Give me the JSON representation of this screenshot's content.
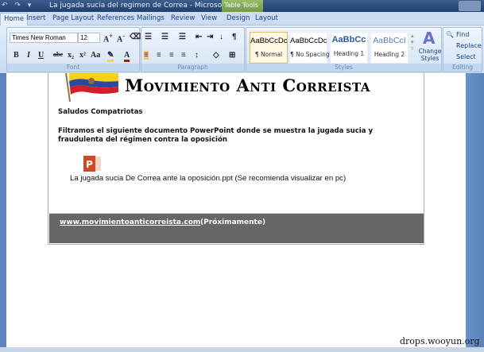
{
  "window": {
    "title": "La jugada sucia del regimen de Correa - Microsoft W...",
    "contextual_tab": "Table Tools"
  },
  "tabs": [
    "Home",
    "Insert",
    "Page Layout",
    "References",
    "Mailings",
    "Review",
    "View",
    "Design",
    "Layout"
  ],
  "font": {
    "name": "Times New Roman",
    "size": "12",
    "group_label": "Font"
  },
  "paragraph": {
    "group_label": "Paragraph"
  },
  "styles": {
    "group_label": "Styles",
    "items": [
      {
        "preview": "AaBbCcDc",
        "name": "¶ Normal",
        "color": "#000000"
      },
      {
        "preview": "AaBbCcDc",
        "name": "¶ No Spacing",
        "color": "#000000"
      },
      {
        "preview": "AaBbCc",
        "name": "Heading 1",
        "color": "#2b5aa0"
      },
      {
        "preview": "AaBbCcI",
        "name": "Heading 2",
        "color": "#4f81bd"
      }
    ],
    "change_styles": "Change Styles"
  },
  "editing": {
    "group_label": "Editing",
    "find": "Find",
    "replace": "Replace",
    "select": "Select"
  },
  "document": {
    "heading": "Movimiento Anti Correista",
    "greeting": "Saludos Compatriotas",
    "body": "Filtramos el siguiente documento PowerPoint donde se muestra la jugada sucia y fraudulenta del régimen contra la oposición",
    "attachment": "La jugada sucia De Correa ante la oposición.ppt (Se recomienda visualizar en pc)",
    "footer_link": "www.movimientoanticorreista.com",
    "footer_note": "(Próximamente)"
  },
  "watermark": "drops.wooyun.org"
}
